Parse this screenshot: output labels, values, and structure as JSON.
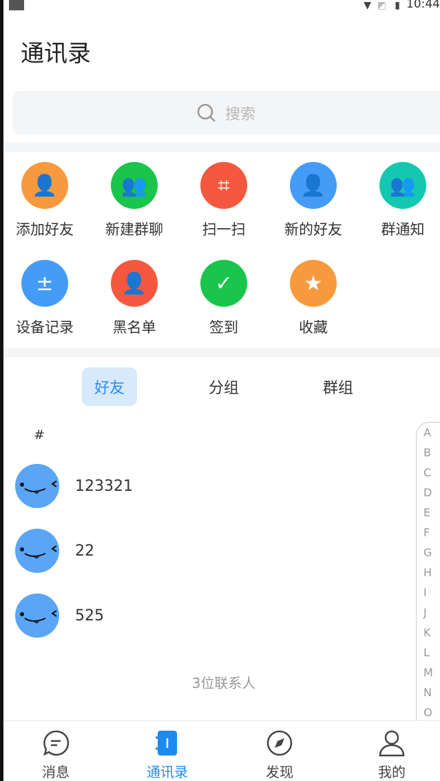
{
  "status": {
    "time": "10:44"
  },
  "header": {
    "title": "通讯录"
  },
  "search": {
    "placeholder": "搜索",
    "icon": "search-icon"
  },
  "grid": [
    {
      "label": "添加好友",
      "color": "#f79a3e",
      "icon": "add-friend-icon"
    },
    {
      "label": "新建群聊",
      "color": "#19c54a",
      "icon": "new-group-icon"
    },
    {
      "label": "扫一扫",
      "color": "#f4583f",
      "icon": "scan-icon"
    },
    {
      "label": "新的好友",
      "color": "#449cf6",
      "icon": "user-icon"
    },
    {
      "label": "群通知",
      "color": "#14c7b0",
      "icon": "group-icon"
    },
    {
      "label": "设备记录",
      "color": "#449cf6",
      "icon": "device-record-icon"
    },
    {
      "label": "黑名单",
      "color": "#f4583f",
      "icon": "blacklist-icon"
    },
    {
      "label": "签到",
      "color": "#19c54a",
      "icon": "calendar-check-icon"
    },
    {
      "label": "收藏",
      "color": "#f79a3e",
      "icon": "star-icon"
    }
  ],
  "tabs": [
    {
      "label": "好友",
      "active": true
    },
    {
      "label": "分组"
    },
    {
      "label": "群组"
    }
  ],
  "section": "#",
  "contacts": [
    {
      "name": "123321"
    },
    {
      "name": "22"
    },
    {
      "name": "525"
    }
  ],
  "contact_count": "3位联系人",
  "index": [
    "A",
    "B",
    "C",
    "D",
    "E",
    "F",
    "G",
    "H",
    "I",
    "J",
    "K",
    "L",
    "M",
    "N",
    "O"
  ],
  "nav": [
    {
      "label": "消息"
    },
    {
      "label": "通讯录",
      "active": true
    },
    {
      "label": "发现"
    },
    {
      "label": "我的"
    }
  ],
  "colors": {
    "accent": "#1d8af0"
  }
}
